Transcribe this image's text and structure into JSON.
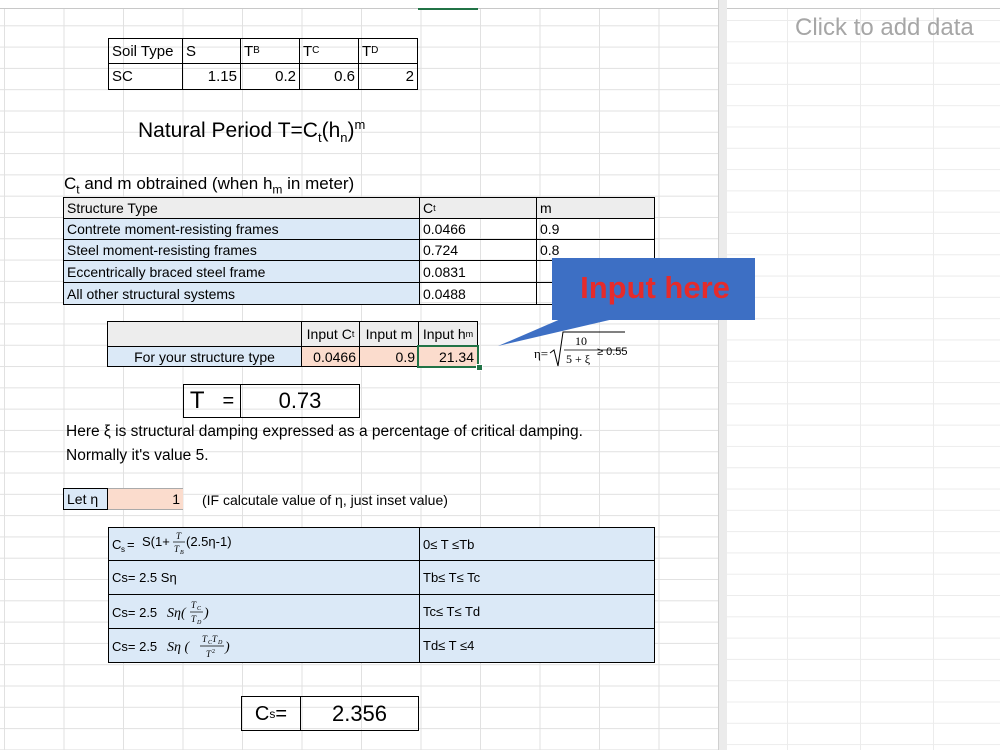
{
  "right_pane": {
    "placeholder": "Click to add data"
  },
  "soil": {
    "headers": [
      "Soil Type",
      "S",
      "TB",
      "TC",
      "TD"
    ],
    "header_main": [
      "Soil Type",
      "S",
      "T",
      "T",
      "T"
    ],
    "header_sub": [
      "",
      "",
      "B",
      "C",
      "D"
    ],
    "row": [
      "SC",
      "1.15",
      "0.2",
      "0.6",
      "2"
    ]
  },
  "title": {
    "text": "Natural Period T=C",
    "sub1": "t",
    "mid": "(h",
    "sub2": "n",
    "close": ")",
    "sup": "m"
  },
  "ct_heading": {
    "c": "C",
    "c_sub": "t",
    "text": " and m obtrained (when h",
    "h_sub": "m",
    "end": " in meter)"
  },
  "structure_table": {
    "headers": [
      "Structure Type",
      "C",
      "m"
    ],
    "header_ct_sub": "t",
    "rows": [
      [
        "Contrete moment-resisting frames",
        "0.0466",
        "0.9"
      ],
      [
        "Steel moment-resisting frames",
        "0.724",
        "0.8"
      ],
      [
        "Eccentrically braced steel frame",
        "0.0831",
        ""
      ],
      [
        "All other structural systems",
        "0.0488",
        ""
      ]
    ]
  },
  "callout": {
    "text": "Input here"
  },
  "input_table": {
    "h_ct": "Input C",
    "h_ct_sub": "t",
    "h_m": "Input m",
    "h_hm": "Input h",
    "h_hm_sub": "m",
    "row_label": "For your structure type",
    "ct": "0.0466",
    "m": "0.9",
    "hm": "21.34"
  },
  "eta_formula": {
    "lhs": "η=",
    "num": "10",
    "den": "5 + ξ",
    "rhs": "≥ 0.55"
  },
  "period": {
    "label": "T",
    "eq": "=",
    "value": "0.73"
  },
  "notes": {
    "line1": "Here ξ is structural damping expressed as a percentage of critical damping.",
    "line2": "Normally it's value 5."
  },
  "eta": {
    "label": "Let η",
    "value": "1",
    "note": "(IF calcutale value of η, just inset value)"
  },
  "cs_table": {
    "rows": [
      {
        "formula": "Cs= S(1+T/TB(2.5η-1)",
        "range": "0≤ T ≤Tb"
      },
      {
        "formula": "Cs= 2.5 Sη",
        "range": "Tb≤ T≤ Tc"
      },
      {
        "formula": "Cs= 2.5 Sη(TC/TD)",
        "range": "Tc≤ T≤ Td"
      },
      {
        "formula": "Cs= 2.5 Sη (TCTD/T²)",
        "range": "Td≤ T ≤4"
      }
    ]
  },
  "cs_result": {
    "label": "C",
    "label_sub": "s",
    "eq": " =",
    "value": "2.356"
  },
  "colors": {
    "blue_fill": "#dbe9f7",
    "gray_fill": "#ededed",
    "peach_fill": "#fbdccd",
    "callout_bg": "#3d6fc4",
    "callout_text": "#e52b2b",
    "excel_green": "#217346"
  }
}
